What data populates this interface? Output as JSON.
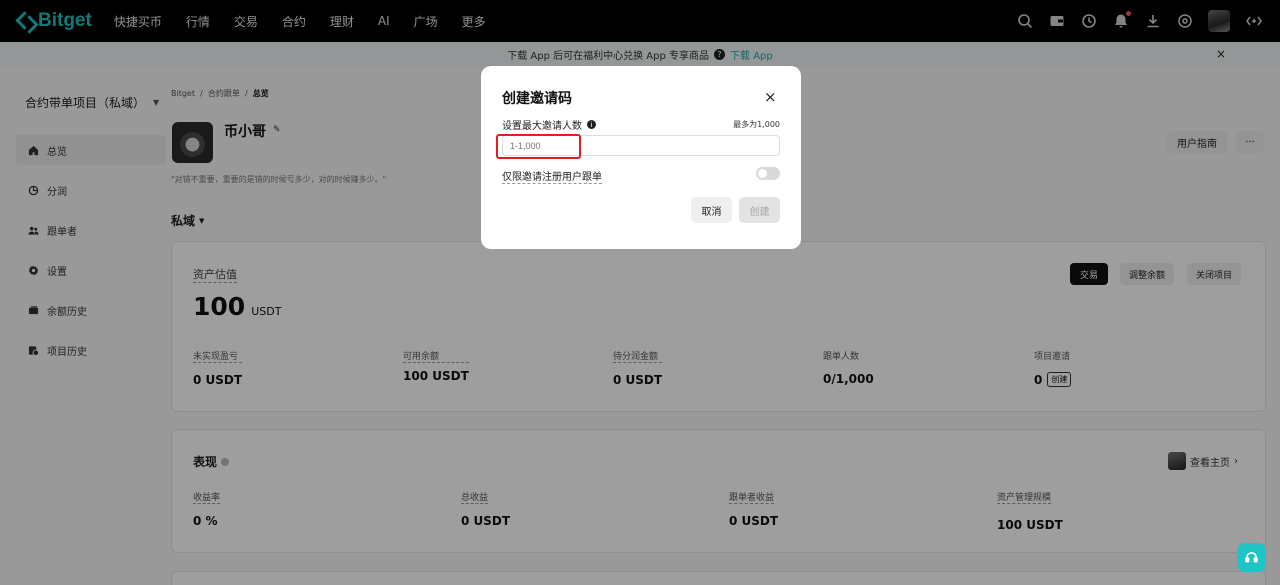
{
  "nav": {
    "logo": "Bitget",
    "items": [
      "快捷买币",
      "行情",
      "交易",
      "合约",
      "理财",
      "AI",
      "广场",
      "更多"
    ]
  },
  "banner": {
    "text": "下载 App 后可在福利中心兑换 App 专享商品",
    "link": "下载 App",
    "close": "×"
  },
  "sidebar": {
    "project_title": "合约带单项目（私域）",
    "items": [
      {
        "label": "总览",
        "icon": "home-icon"
      },
      {
        "label": "分润",
        "icon": "pie-icon"
      },
      {
        "label": "跟单者",
        "icon": "users-icon"
      },
      {
        "label": "设置",
        "icon": "gear-icon"
      },
      {
        "label": "余额历史",
        "icon": "wallet-icon"
      },
      {
        "label": "项目历史",
        "icon": "history-icon"
      }
    ]
  },
  "breadcrumb": {
    "a": "Bitget",
    "b": "合约跟单",
    "c": "总览",
    "sep": "/"
  },
  "profile": {
    "name": "币小哥",
    "quote": "\"对错不重要，重要的是错的时候亏多少，对的时候赚多少。\"",
    "guide": "用户指南",
    "more": "···"
  },
  "privacy_label": "私域",
  "asset": {
    "label": "资产估值",
    "value": "100",
    "unit": "USDT",
    "btn_trade": "交易",
    "btn_adjust": "调整余额",
    "btn_close": "关闭项目",
    "stats": [
      {
        "label": "未实现盈亏",
        "value": "0 USDT"
      },
      {
        "label": "可用余额",
        "value": "100 USDT"
      },
      {
        "label": "待分润金额",
        "value": "0 USDT"
      },
      {
        "label": "跟单人数",
        "value": "0/1,000"
      },
      {
        "label": "项目邀请",
        "value": "0",
        "action": "创建"
      }
    ]
  },
  "performance": {
    "title": "表现",
    "home_link": "查看主页",
    "stats": [
      {
        "label": "收益率",
        "value": "0 %"
      },
      {
        "label": "总收益",
        "value": "0 USDT"
      },
      {
        "label": "跟单者收益",
        "value": "0 USDT"
      },
      {
        "label": "资产管理规模",
        "value": "100 USDT"
      }
    ]
  },
  "modal": {
    "title": "创建邀请码",
    "close": "×",
    "field_label": "设置最大邀请人数",
    "max_hint": "最多为1,000",
    "placeholder": "1-1,000",
    "checkbox_label": "仅限邀请注册用户跟单",
    "cancel": "取消",
    "create": "创建"
  }
}
